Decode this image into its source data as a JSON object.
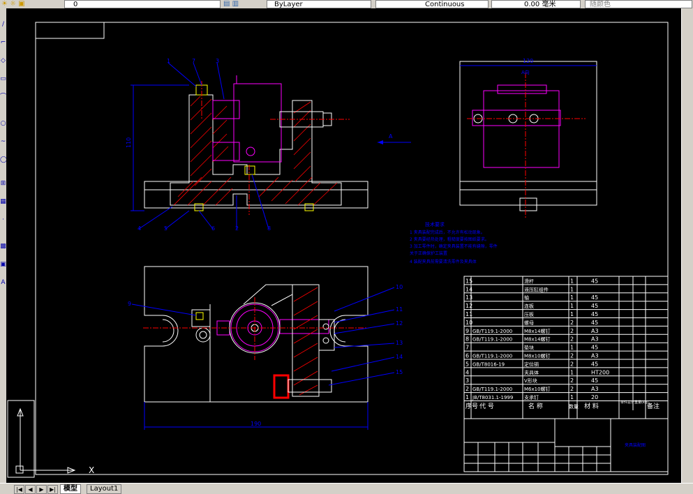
{
  "toolbar": {
    "layer_value": "0",
    "linetype_bylayer": "ByLayer",
    "linetype_value": "Continuous",
    "lineweight_value": "0.00 毫米",
    "color_value": "随颜色"
  },
  "layout_tabs": [
    "模型",
    "Layout1"
  ],
  "drawing": {
    "views": {
      "front_balloons": [
        "1",
        "7",
        "3",
        "4",
        "5",
        "6",
        "2",
        "8"
      ],
      "front_height_dim": "110",
      "side_width_dim": "120",
      "view_marker": "A",
      "side_view_label": "A向",
      "top_view_dim": "190",
      "top_view_balloon_left": "9",
      "top_view_balloons_right": [
        "10",
        "11",
        "12",
        "13",
        "14",
        "15"
      ]
    },
    "notes": {
      "title": "技术要求",
      "lines": [
        "1  夹具装配完成后，不允许有松动现象。",
        "2  夹具要经热处理，粗糙度要按图纸要求。",
        "3  加工零件时，确定夹具装置不能有缝隙，零件",
        "   关于正确保护工装置",
        "4  装配夹具前需要清洗零件及夹具体"
      ]
    },
    "bom": {
      "rows": [
        {
          "no": "15",
          "code": "",
          "name": "滑杆",
          "qty": "1",
          "material": "45"
        },
        {
          "no": "14",
          "code": "",
          "name": "液压缸组件",
          "qty": "1",
          "material": ""
        },
        {
          "no": "13",
          "code": "",
          "name": "轴",
          "qty": "1",
          "material": "45"
        },
        {
          "no": "12",
          "code": "",
          "name": "连板",
          "qty": "1",
          "material": "45"
        },
        {
          "no": "11",
          "code": "",
          "name": "压板",
          "qty": "1",
          "material": "45"
        },
        {
          "no": "10",
          "code": "",
          "name": "螺母",
          "qty": "2",
          "material": "45"
        },
        {
          "no": "9",
          "code": "GB/T119.1-2000",
          "name": "M8x14螺钉",
          "qty": "2",
          "material": "A3"
        },
        {
          "no": "8",
          "code": "GB/T119.1-2000",
          "name": "M8x14螺钉",
          "qty": "2",
          "material": "A3"
        },
        {
          "no": "7",
          "code": "",
          "name": "垫块",
          "qty": "1",
          "material": "45"
        },
        {
          "no": "6",
          "code": "GB/T119.1-2000",
          "name": "M8x10螺钉",
          "qty": "2",
          "material": "A3"
        },
        {
          "no": "5",
          "code": "GB/T8016-19",
          "name": "定位销",
          "qty": "2",
          "material": "45"
        },
        {
          "no": "4",
          "code": "",
          "name": "夹具体",
          "qty": "1",
          "material": "HT200"
        },
        {
          "no": "3",
          "code": "",
          "name": "V形块",
          "qty": "2",
          "material": "45"
        },
        {
          "no": "2",
          "code": "GB/T119.1-2000",
          "name": "M6x10螺钉",
          "qty": "2",
          "material": "A3"
        },
        {
          "no": "1",
          "code": "JB/T8031.1-1999",
          "name": "支承钉",
          "qty": "1",
          "material": "20"
        }
      ],
      "header": {
        "no": "序号",
        "code": "代  号",
        "name": "名  称",
        "qty": "数量",
        "material": "材  料",
        "weight": "单件总计重量(kg)",
        "remark": "备注"
      }
    },
    "title_block": {
      "drawing_name": "夹具装配图"
    }
  },
  "colors": {
    "canvas": "#000000",
    "frame": "#ffffff",
    "part_outline": "#ffffff",
    "section_hatch": "#ff0000",
    "hidden_parts": "#ff00ff",
    "dimensions": "#0000ff",
    "leader": "#0000ff",
    "bom_text": "#ffffff"
  }
}
